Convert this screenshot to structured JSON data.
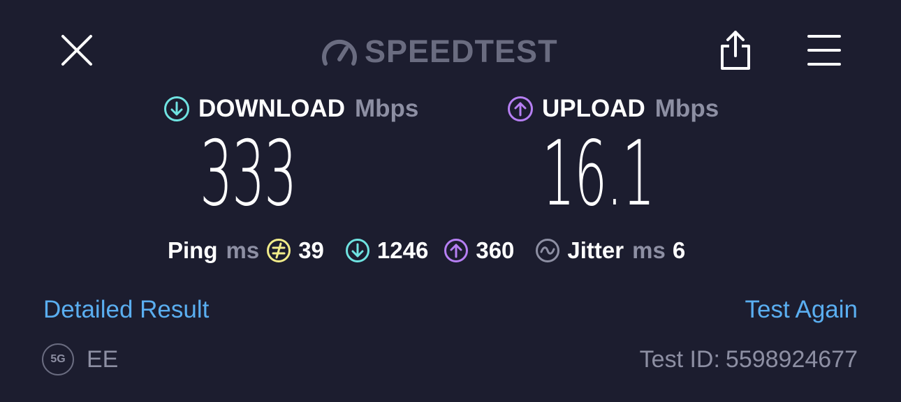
{
  "header": {
    "brand": "SPEEDTEST",
    "icons": [
      "close-icon",
      "speedometer-icon",
      "share-icon",
      "menu-icon"
    ]
  },
  "download": {
    "label": "DOWNLOAD",
    "unit": "Mbps",
    "value": "333"
  },
  "upload": {
    "label": "UPLOAD",
    "unit": "Mbps",
    "value": "16.1"
  },
  "stats": {
    "ping_label": "Ping",
    "ping_unit": "ms",
    "idle_ping": "39",
    "download_ping": "1246",
    "upload_ping": "360",
    "jitter_label": "Jitter",
    "jitter_unit": "ms",
    "jitter_value": "6"
  },
  "links": {
    "detailed_result": "Detailed Result",
    "test_again": "Test Again"
  },
  "footer": {
    "network_badge": "5G",
    "carrier": "EE",
    "test_id_label": "Test ID:",
    "test_id": "5598924677"
  },
  "colors": {
    "background": "#1c1d2f",
    "download_accent": "#6fe3e1",
    "upload_accent": "#b67ff3",
    "ping_accent": "#f1ec8a",
    "link": "#5aaef0",
    "muted": "#8d8fa3"
  }
}
